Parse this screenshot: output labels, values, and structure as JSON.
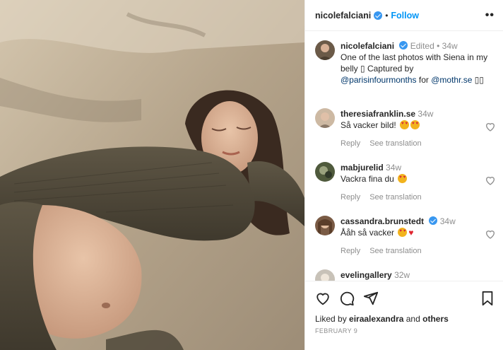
{
  "post": {
    "author": "nicolefalciani",
    "follow_label": "Follow",
    "more_label": "••"
  },
  "caption": {
    "username": "nicolefalciani",
    "edited": "Edited",
    "time": "34w",
    "text_line1": "One of the last photos with Siena in my",
    "text_line2": "belly ▯ Captured by",
    "mention1": "@parisinfourmonths",
    "for_word": " for ",
    "mention2": "@mothr.se",
    "tail": " ▯▯"
  },
  "comments": [
    {
      "username": "theresiafranklin.se",
      "time": "34w",
      "text": "Så vacker bild!",
      "reply": "Reply",
      "translate": "See translation",
      "emoji": "heart-eyes-icon heart-eyes-icon"
    },
    {
      "username": "mabjurelid",
      "time": "34w",
      "text": "Vackra fina du",
      "reply": "Reply",
      "translate": "See translation",
      "emoji": "heart-eyes-icon"
    },
    {
      "username": "cassandra.brunstedt",
      "time": "34w",
      "text": "Ååh så vacker",
      "reply": "Reply",
      "translate": "See translation",
      "emoji": "heart-eyes-icon red-heart-icon"
    },
    {
      "username": "evelingallery",
      "time": "32w"
    }
  ],
  "likes": {
    "prefix": "Liked by ",
    "user": "eiraalexandra",
    "middle": " and ",
    "others": "others"
  },
  "date": "FEBRUARY 9",
  "colors": {
    "accent": "#0095f6",
    "verified": "#3897f0",
    "muted": "#8e8e8e"
  }
}
